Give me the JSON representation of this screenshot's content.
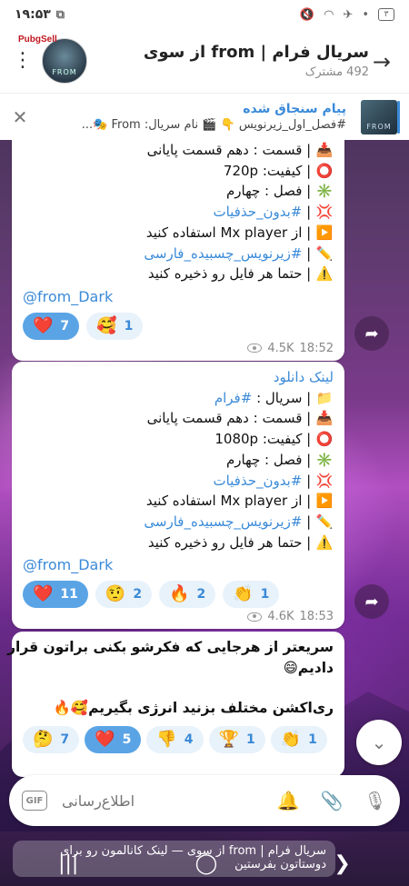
{
  "status_bar": {
    "time": "۱۹:۵۳",
    "badge": "۳"
  },
  "header": {
    "title": "سریال فرام | from از سوی",
    "subscribers": "492 مشترک",
    "brand": "PubgSell"
  },
  "pinned": {
    "title": "پیام سنجاق شده",
    "text": "#فصل_اول_زیرنویس 👇 🎬 نام سریال: From 🎭..."
  },
  "messages": [
    {
      "lines": [
        {
          "emoji": "📥",
          "text": "| قسمت : دهم قسمت پایانی"
        },
        {
          "emoji": "⭕",
          "text": "| کیفیت: 720p"
        },
        {
          "emoji": "✳️",
          "text": "| فصل : چهارم"
        },
        {
          "emoji": "💢",
          "text": "| ",
          "tag": "#بدون_حذفیات"
        },
        {
          "emoji": "▶️",
          "text": "| از Mx player استفاده کنید"
        },
        {
          "emoji": "✏️",
          "text": "| ",
          "tag": "#زیرنویس_چسبیده_فارسی"
        },
        {
          "emoji": "⚠️",
          "text": "| حتما هر فایل رو ذخیره کنید"
        }
      ],
      "handle": "@from_Dark",
      "reactions": [
        {
          "emoji": "❤️",
          "count": "7",
          "selected": true
        },
        {
          "emoji": "🥰",
          "count": "1",
          "selected": false
        }
      ],
      "views": "4.5K",
      "time": "18:52"
    },
    {
      "title": "لینک دانلود",
      "lines": [
        {
          "emoji": "📁",
          "text": "| سریال : ",
          "tag": "#فرام"
        },
        {
          "emoji": "📥",
          "text": "| قسمت : دهم قسمت پایانی"
        },
        {
          "emoji": "⭕",
          "text": "| کیفیت: 1080p"
        },
        {
          "emoji": "✳️",
          "text": "| فصل : چهارم"
        },
        {
          "emoji": "💢",
          "text": "| ",
          "tag": "#بدون_حذفیات"
        },
        {
          "emoji": "▶️",
          "text": "| از Mx player استفاده کنید"
        },
        {
          "emoji": "✏️",
          "text": "| ",
          "tag": "#زیرنویس_چسبیده_فارسی"
        },
        {
          "emoji": "⚠️",
          "text": "| حتما هر فایل رو ذخیره کنید"
        }
      ],
      "handle": "@from_Dark",
      "reactions": [
        {
          "emoji": "❤️",
          "count": "11",
          "selected": true
        },
        {
          "emoji": "🤨",
          "count": "2",
          "selected": false
        },
        {
          "emoji": "🔥",
          "count": "2",
          "selected": false
        },
        {
          "emoji": "👏",
          "count": "1",
          "selected": false
        }
      ],
      "views": "4.6K",
      "time": "18:53"
    },
    {
      "lines": [
        {
          "text": "سریعتر از هرجایی که فکرشو بکنی براتون قرار"
        },
        {
          "text": "دادیم😄"
        },
        {
          "text": ""
        },
        {
          "text": "ری‌اکشن مختلف بزنید انرژی بگیریم🥰🔥"
        }
      ],
      "reactions": [
        {
          "emoji": "🤔",
          "count": "7",
          "selected": false
        },
        {
          "emoji": "❤️",
          "count": "5",
          "selected": true
        },
        {
          "emoji": "👎",
          "count": "4",
          "selected": false
        },
        {
          "emoji": "🏆",
          "count": "1",
          "selected": false
        },
        {
          "emoji": "👏",
          "count": "1",
          "selected": false
        }
      ]
    }
  ],
  "input": {
    "placeholder": "اطلاع‌رسانی"
  },
  "preview": {
    "text": "سریال فرام | from از سوی — لینک کانالمون رو برای دوستاتون بفرستین"
  }
}
